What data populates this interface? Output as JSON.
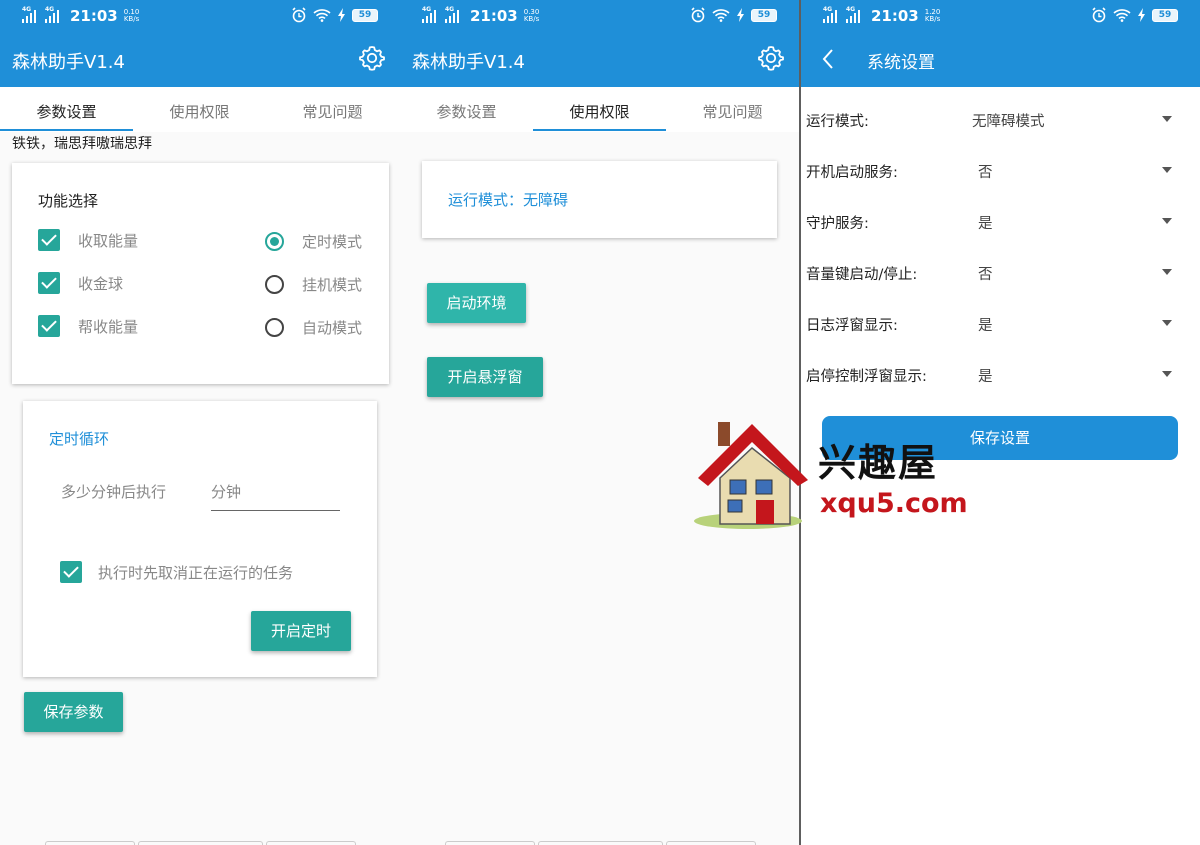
{
  "status_bar": {
    "screen1": {
      "time": "21:03",
      "speed": "0.10",
      "speed_unit": "KB/s",
      "battery": "59"
    },
    "screen2": {
      "time": "21:03",
      "speed": "0.30",
      "speed_unit": "KB/s",
      "battery": "59"
    },
    "screen3": {
      "time": "21:03",
      "speed": "1.20",
      "speed_unit": "KB/s",
      "battery": "59"
    },
    "network": "4G"
  },
  "app_title": "森林助手V1.4",
  "tabs": [
    "参数设置",
    "使用权限",
    "常见问题"
  ],
  "screen1": {
    "marquee": "铁铁，瑞思拜嗷瑞思拜",
    "function_card": {
      "title": "功能选择",
      "checkboxes": [
        "收取能量",
        "收金球",
        "帮收能量"
      ],
      "radios": [
        "定时模式",
        "挂机模式",
        "自动模式"
      ]
    },
    "timer_card": {
      "title": "定时循环",
      "label": "多少分钟后执行",
      "input_placeholder": "分钟",
      "checkbox": "执行时先取消正在运行的任务",
      "button": "开启定时"
    },
    "save_button": "保存参数"
  },
  "screen2": {
    "mode_text": "运行模式：无障碍",
    "start_env_button": "启动环境",
    "float_button": "开启悬浮窗"
  },
  "screen3": {
    "title": "系统设置",
    "rows": [
      {
        "label": "运行模式:",
        "value": "无障碍模式"
      },
      {
        "label": "开机启动服务:",
        "value": "否"
      },
      {
        "label": "守护服务:",
        "value": "是"
      },
      {
        "label": "音量键启动/停止:",
        "value": "否"
      },
      {
        "label": "日志浮窗显示:",
        "value": "是"
      },
      {
        "label": "启停控制浮窗显示:",
        "value": "是"
      }
    ],
    "save_button": "保存设置"
  },
  "watermark": {
    "big": "兴趣屋",
    "small": "xqu5.com"
  },
  "colors": {
    "primary": "#1f8fd8",
    "accent": "#26a69a"
  },
  "icons": [
    "gear-icon",
    "back-arrow-icon",
    "alarm-icon",
    "wifi-icon",
    "charge-icon",
    "battery-icon",
    "signal-icon",
    "house-logo-icon"
  ]
}
